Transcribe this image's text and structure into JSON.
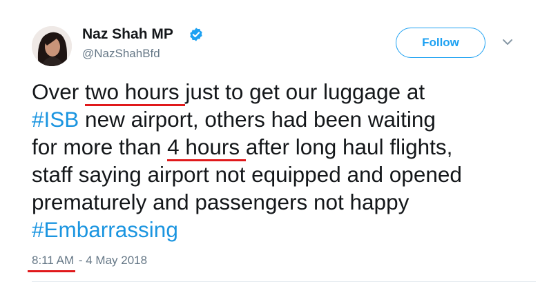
{
  "author": {
    "display_name": "Naz Shah MP",
    "handle": "@NazShahBfd",
    "verified": true,
    "verified_icon": "verified-badge-icon",
    "avatar_icon": "profile-photo"
  },
  "actions": {
    "follow_label": "Follow",
    "menu_icon": "chevron-down-icon"
  },
  "tweet": {
    "line1": {
      "a": "Over ",
      "b": "two hours ",
      "c": "just to get our luggage at"
    },
    "line2": {
      "hashtag": "#ISB",
      "rest": " new airport, others had been waiting"
    },
    "line3": {
      "a": "for more than ",
      "b": "4 hours ",
      "c": "after long haul flights,"
    },
    "line4": "staff saying airport not equipped and opened",
    "line5": "prematurely and passengers not happy",
    "line6_hashtag": "#Embarrassing"
  },
  "timestamp": {
    "time": "8:11 AM",
    "separator": " - ",
    "date": "4 May 2018"
  },
  "colors": {
    "accent": "#1da1f2",
    "hashtag": "#1b95e0",
    "annotation_underline": "#e0191b",
    "secondary_text": "#657786"
  }
}
